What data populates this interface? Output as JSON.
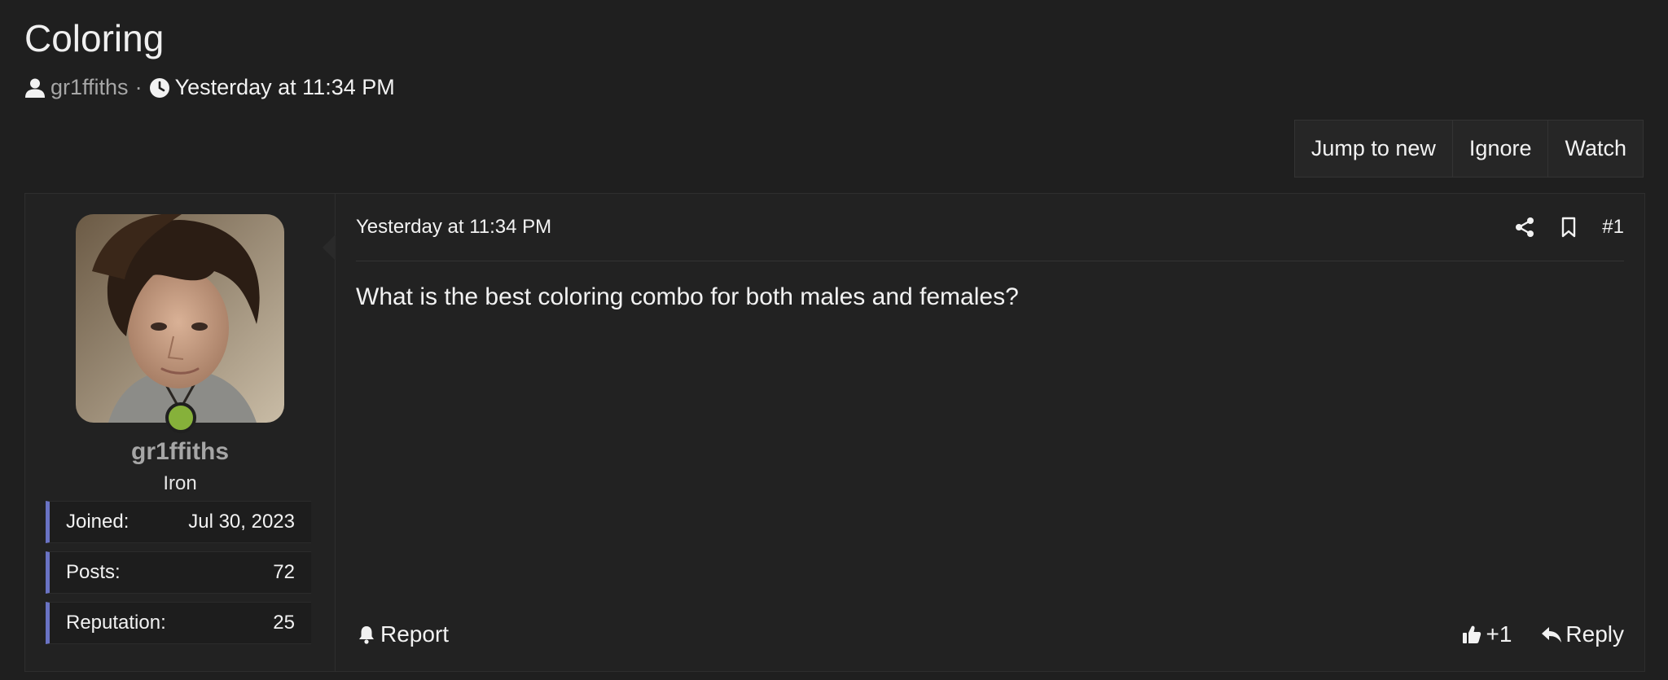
{
  "thread": {
    "title": "Coloring",
    "author": "gr1ffiths",
    "separator": "·",
    "time": "Yesterday at 11:34 PM"
  },
  "actions": {
    "jump_to_new": "Jump to new",
    "ignore": "Ignore",
    "watch": "Watch"
  },
  "user": {
    "name": "gr1ffiths",
    "rank": "Iron",
    "status_color": "#86b13a",
    "stats": [
      {
        "label": "Joined:",
        "value": "Jul 30, 2023"
      },
      {
        "label": "Posts:",
        "value": "72"
      },
      {
        "label": "Reputation:",
        "value": "25"
      }
    ]
  },
  "post": {
    "date": "Yesterday at 11:34 PM",
    "number": "#1",
    "message": "What is the best coloring combo for both males and females?",
    "report_label": "Report",
    "like_label": "+1",
    "reply_label": "Reply"
  },
  "icons": {
    "author": "user-icon",
    "time": "clock-icon",
    "share": "share-icon",
    "bookmark": "bookmark-icon",
    "report": "bell-icon",
    "like": "thumbs-up-icon",
    "reply": "reply-arrow-icon"
  },
  "colors": {
    "background": "#1f1f1f",
    "stat_accent": "#6a73c4",
    "muted_text": "#a6a6a6"
  }
}
